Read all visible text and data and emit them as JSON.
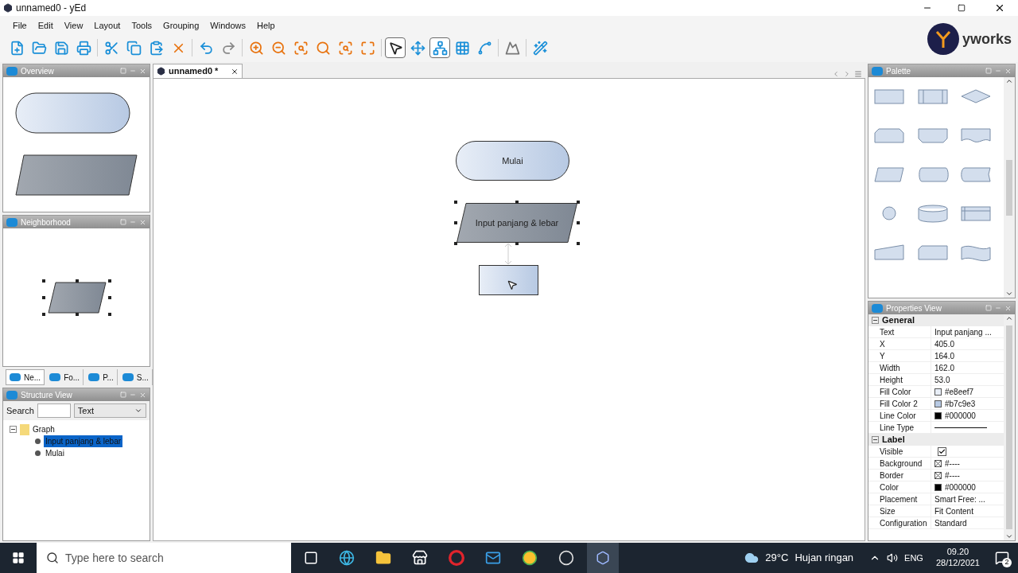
{
  "window": {
    "title": "unnamed0 - yEd"
  },
  "menu": [
    "File",
    "Edit",
    "View",
    "Layout",
    "Tools",
    "Grouping",
    "Windows",
    "Help"
  ],
  "toolbar": [
    {
      "kind": "new",
      "selected": false
    },
    {
      "kind": "open",
      "selected": false
    },
    {
      "kind": "save",
      "selected": false
    },
    {
      "kind": "print",
      "selected": false
    },
    {
      "kind": "separator"
    },
    {
      "kind": "cut",
      "selected": false
    },
    {
      "kind": "copy",
      "selected": false
    },
    {
      "kind": "paste",
      "selected": false
    },
    {
      "kind": "delete",
      "selected": false
    },
    {
      "kind": "separator"
    },
    {
      "kind": "undo",
      "selected": false
    },
    {
      "kind": "redo",
      "selected": false
    },
    {
      "kind": "separator"
    },
    {
      "kind": "zoom-in",
      "selected": false
    },
    {
      "kind": "zoom-out",
      "selected": false
    },
    {
      "kind": "zoom-fit",
      "selected": false
    },
    {
      "kind": "zoom",
      "selected": false
    },
    {
      "kind": "zoom-area",
      "selected": false
    },
    {
      "kind": "fit",
      "selected": false
    },
    {
      "kind": "separator"
    },
    {
      "kind": "edit-mode",
      "selected": true
    },
    {
      "kind": "move",
      "selected": false
    },
    {
      "kind": "hierarchy",
      "selected": true
    },
    {
      "kind": "grid",
      "selected": false
    },
    {
      "kind": "route",
      "selected": false
    },
    {
      "kind": "separator"
    },
    {
      "kind": "upload",
      "selected": false
    },
    {
      "kind": "separator"
    },
    {
      "kind": "wand",
      "selected": false
    }
  ],
  "logo": {
    "text": "yworks"
  },
  "overview": {
    "title": "Overview"
  },
  "neighborhood": {
    "title": "Neighborhood"
  },
  "left_tabs": [
    {
      "label": "Ne...",
      "selected": true
    },
    {
      "label": "Fo...",
      "selected": false
    },
    {
      "label": "P...",
      "selected": false
    },
    {
      "label": "S...",
      "selected": false
    }
  ],
  "structure": {
    "title": "Structure View",
    "search_label": "Search",
    "filter": "Text",
    "tree": {
      "label": "Graph",
      "expanded": true,
      "children": [
        {
          "label": "Input panjang & lebar",
          "selected": true
        },
        {
          "label": "Mulai",
          "selected": false
        }
      ]
    }
  },
  "document_tab": {
    "label": "unnamed0 *",
    "selected": true
  },
  "nodes": [
    {
      "kind": "terminator",
      "text": "Mulai",
      "selected": false
    },
    {
      "kind": "parallelogram",
      "text": "Input panjang & lebar",
      "selected": true
    },
    {
      "kind": "process",
      "selected": false
    }
  ],
  "palette": {
    "title": "Palette"
  },
  "properties": {
    "title": "Properties View",
    "sections": [
      {
        "title": "General",
        "expanded": true,
        "rows": [
          {
            "label": "Text",
            "value": "Input panjang ..."
          },
          {
            "label": "X",
            "value": "405.0"
          },
          {
            "label": "Y",
            "value": "164.0"
          },
          {
            "label": "Width",
            "value": "162.0"
          },
          {
            "label": "Height",
            "value": "53.0"
          },
          {
            "label": "Fill Color",
            "kind": "color",
            "color": "#e8eef7",
            "value": "#e8eef7"
          },
          {
            "label": "Fill Color 2",
            "kind": "color",
            "color": "#b7c9e3",
            "value": "#b7c9e3"
          },
          {
            "label": "Line Color",
            "kind": "color",
            "color": "#000000",
            "value": "#000000"
          },
          {
            "label": "Line Type",
            "kind": "line"
          }
        ]
      },
      {
        "title": "Label",
        "expanded": true,
        "rows": [
          {
            "label": "Visible",
            "kind": "checkbox",
            "checked": true
          },
          {
            "label": "Background",
            "kind": "none",
            "value": "#----"
          },
          {
            "label": "Border",
            "kind": "none",
            "value": "#----"
          },
          {
            "label": "Color",
            "kind": "color",
            "color": "#000000",
            "value": "#000000"
          },
          {
            "label": "Placement",
            "value": "Smart Free: ..."
          },
          {
            "label": "Size",
            "value": "Fit Content"
          },
          {
            "label": "Configuration",
            "value": "Standard"
          }
        ]
      }
    ]
  },
  "taskbar": {
    "search_placeholder": "Type here to search",
    "temperature": "29°C",
    "weather": "Hujan ringan",
    "language": "ENG",
    "time": "09.20",
    "date": "28/12/2021",
    "notifications": "2"
  }
}
